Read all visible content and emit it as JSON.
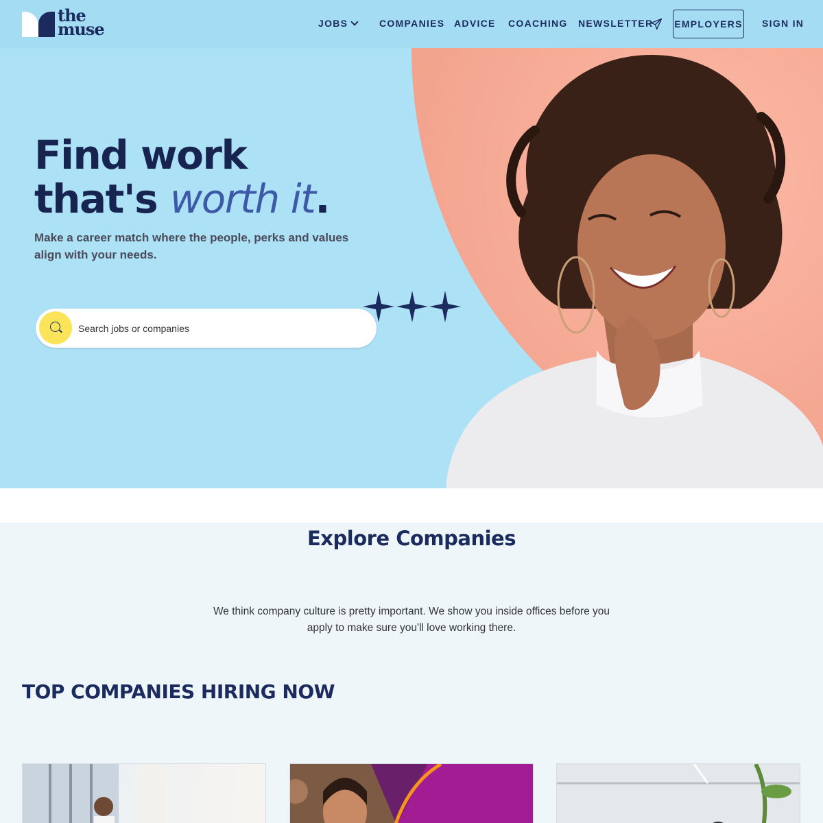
{
  "brand": {
    "line1": "the",
    "line2": "muse"
  },
  "nav": {
    "jobs": "JOBS",
    "companies": "COMPANIES",
    "advice": "ADVICE",
    "coaching": "COACHING",
    "newsletter": "NEWSLETTER",
    "employers": "EMPLOYERS",
    "sign_in": "SIGN IN"
  },
  "hero": {
    "headline_line1": "Find work",
    "headline_line2_plain": "that's ",
    "headline_line2_accent": "worth it",
    "headline_period": ".",
    "subtitle": "Make a career match where the people, perks and values align with your needs.",
    "search_placeholder": "Search jobs or companies"
  },
  "explore": {
    "title": "Explore Companies",
    "body": "We think company culture is pretty important. We show you inside offices before you apply to make sure you'll love working there."
  },
  "top_companies": {
    "title": "TOP COMPANIES HIRING NOW"
  },
  "colors": {
    "header_bg": "#a3dcf3",
    "hero_bg": "#ade1f5",
    "hero_accent": "#f6ab98",
    "navy": "#1b2b5e",
    "search_button": "#fbe35a"
  }
}
